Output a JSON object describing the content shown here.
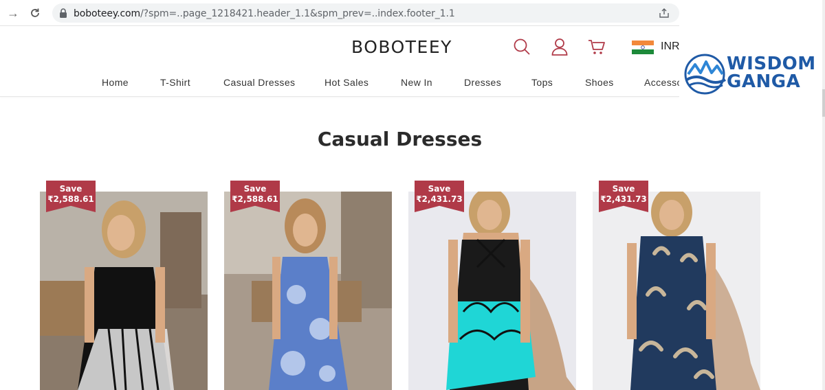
{
  "browser": {
    "url_domain": "boboteey.com",
    "url_rest": "/?spm=..page_1218421.header_1.1&spm_prev=..index.footer_1.1"
  },
  "header": {
    "brand": "BOBOTEEY",
    "currency": "INR",
    "menu": [
      "Home",
      "T-Shirt",
      "Casual Dresses",
      "Hot Sales",
      "New In",
      "Dresses",
      "Tops",
      "Shoes",
      "Accessories"
    ]
  },
  "watermark": {
    "line1": "WISDOM",
    "line2": "GANGA"
  },
  "page": {
    "title": "Casual Dresses"
  },
  "products": [
    {
      "badge_label": "Save",
      "badge_amount": "₹2,588.61",
      "dress_color": "#111111",
      "accent": "#e8e8e8"
    },
    {
      "badge_label": "Save",
      "badge_amount": "₹2,588.61",
      "dress_color": "#5b7fc9",
      "accent": "#c9d8f2"
    },
    {
      "badge_label": "Save",
      "badge_amount": "₹2,431.73",
      "dress_color": "#1a1a1a",
      "accent": "#1fd6d6"
    },
    {
      "badge_label": "Save",
      "badge_amount": "₹2,431.73",
      "dress_color": "#213a5e",
      "accent": "#c8b69a"
    }
  ],
  "colors": {
    "badge": "#b03a48",
    "icon_accent": "#b03a48",
    "logo_blue": "#1f5aa6"
  }
}
